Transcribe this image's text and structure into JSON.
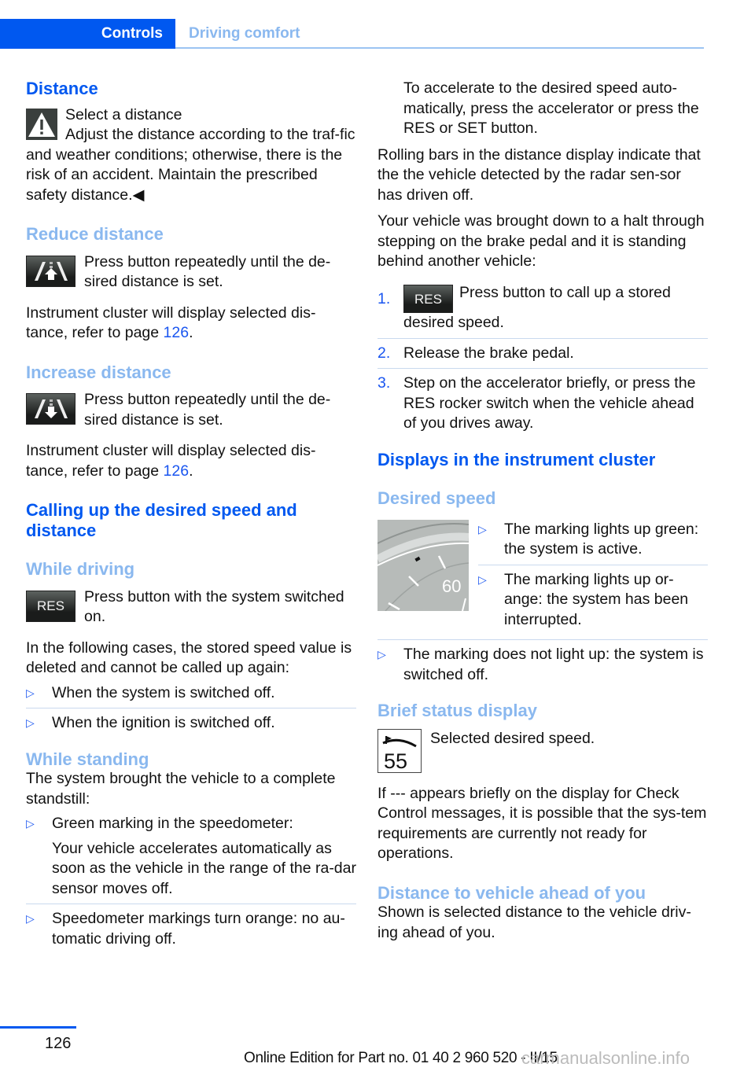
{
  "header": {
    "active_tab": "Controls",
    "inactive_tab": "Driving comfort"
  },
  "left": {
    "distance": {
      "heading": "Distance",
      "warning_title": "Select a distance",
      "warning_text": "Adjust the distance according to the traf-fic and weather conditions; otherwise, there is the risk of an accident. Maintain the prescribed safety distance.◀"
    },
    "reduce": {
      "heading": "Reduce distance",
      "text": "Press button repeatedly until the de-sired distance is set.",
      "note_prefix": "Instrument cluster will display selected dis-tance, refer to page ",
      "page_link": "126",
      "note_suffix": "."
    },
    "increase": {
      "heading": "Increase distance",
      "text": "Press button repeatedly until the de-sired distance is set.",
      "note_prefix": "Instrument cluster will display selected dis-tance, refer to page ",
      "page_link": "126",
      "note_suffix": "."
    },
    "calling": {
      "heading": "Calling up the desired speed and distance"
    },
    "while_driving": {
      "heading": "While driving",
      "button_label": "RES",
      "text": "Press button with the system switched on.",
      "cases_intro": "In the following cases, the stored speed value is deleted and cannot be called up again:",
      "cases": [
        "When the system is switched off.",
        "When the ignition is switched off."
      ]
    },
    "while_standing": {
      "heading": "While standing",
      "intro": "The system brought the vehicle to a complete standstill:",
      "items": [
        {
          "text": "Green marking in the speedometer:",
          "sub": "Your vehicle accelerates automatically as soon as the vehicle in the range of the ra-dar sensor moves off."
        },
        {
          "text": "Speedometer markings turn orange: no au-tomatic driving off.",
          "sub": ""
        }
      ]
    }
  },
  "right": {
    "continued": "To accelerate to the desired speed auto-matically, press the accelerator or press the RES or SET button.",
    "rolling_bars": "Rolling bars in the distance display indicate that the the vehicle detected by the radar sen-sor has driven off.",
    "halt_intro": "Your vehicle was brought down to a halt through stepping on the brake pedal and it is standing behind another vehicle:",
    "steps": [
      {
        "num": "1.",
        "button_label": "RES",
        "text": "Press button to call up a stored desired speed."
      },
      {
        "num": "2.",
        "text": "Release the brake pedal."
      },
      {
        "num": "3.",
        "text": "Step on the accelerator briefly, or press the RES rocker switch when the vehicle ahead of you drives away."
      }
    ],
    "displays_heading": "Displays in the instrument cluster",
    "desired_speed": {
      "heading": "Desired speed",
      "gauge_label": "60",
      "items": [
        "The marking lights up green: the system is active.",
        "The marking lights up or-ange: the system has been interrupted.",
        "The marking does not light up: the system is switched off."
      ]
    },
    "brief_status": {
      "heading": "Brief status display",
      "icon_value": "55",
      "text": "Selected desired speed.",
      "note": "If --- appears briefly on the display for Check Control messages, it is possible that the sys-tem requirements are currently not ready for operations."
    },
    "distance_ahead": {
      "heading": "Distance to vehicle ahead of you",
      "text": "Shown is selected distance to the vehicle driv-ing ahead of you."
    }
  },
  "footer": {
    "page_number": "126",
    "edition": "Online Edition for Part no. 01 40 2 960 520 - II/15",
    "watermark": "carmanualsonline.info"
  },
  "colors": {
    "primary_blue": "#0058f0",
    "secondary_blue": "#8ab8ef",
    "link_blue": "#1a56f0"
  }
}
